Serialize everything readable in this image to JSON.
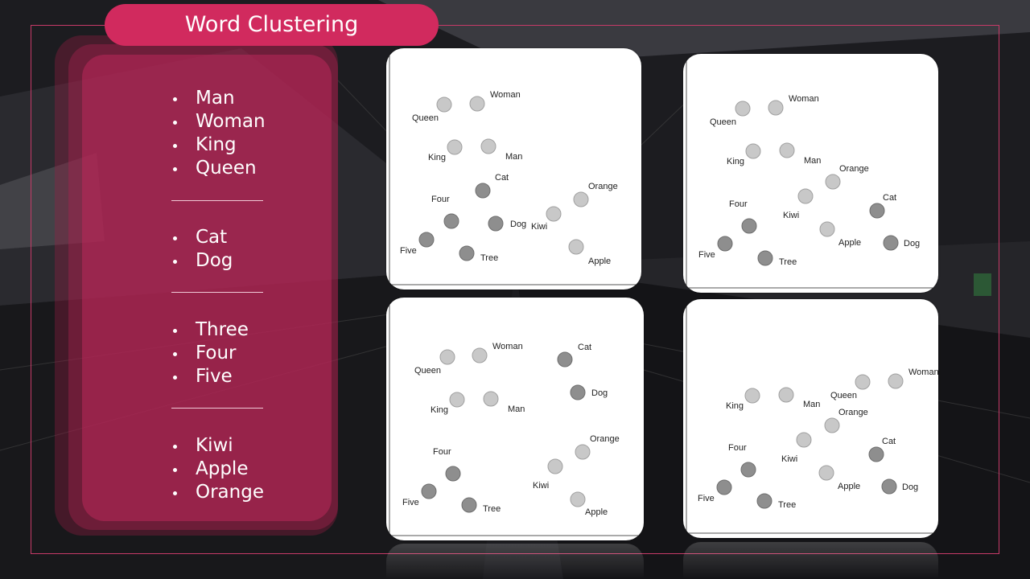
{
  "title": "Word Clustering",
  "colors": {
    "accent": "#d12a5e",
    "frame": "#c63a68",
    "dot_light": "#c8c8c8",
    "dot_dark": "#8e8e8e"
  },
  "word_groups": [
    [
      "Man",
      "Woman",
      "King",
      "Queen"
    ],
    [
      "Cat",
      "Dog"
    ],
    [
      "Three",
      "Four",
      "Five"
    ],
    [
      "Kiwi",
      "Apple",
      "Orange"
    ]
  ],
  "plots": [
    {
      "points": [
        {
          "label": "Queen",
          "tone": "light"
        },
        {
          "label": "Woman",
          "tone": "light"
        },
        {
          "label": "King",
          "tone": "light"
        },
        {
          "label": "Man",
          "tone": "light"
        },
        {
          "label": "Cat",
          "tone": "dark"
        },
        {
          "label": "Four",
          "tone": "dark"
        },
        {
          "label": "Dog",
          "tone": "dark"
        },
        {
          "label": "Five",
          "tone": "dark"
        },
        {
          "label": "Tree",
          "tone": "dark"
        },
        {
          "label": "Kiwi",
          "tone": "light"
        },
        {
          "label": "Orange",
          "tone": "light"
        },
        {
          "label": "Apple",
          "tone": "light"
        }
      ]
    },
    {
      "points": [
        {
          "label": "Queen",
          "tone": "light"
        },
        {
          "label": "Woman",
          "tone": "light"
        },
        {
          "label": "King",
          "tone": "light"
        },
        {
          "label": "Man",
          "tone": "light"
        },
        {
          "label": "Orange",
          "tone": "light"
        },
        {
          "label": "Kiwi",
          "tone": "light"
        },
        {
          "label": "Four",
          "tone": "dark"
        },
        {
          "label": "Cat",
          "tone": "dark"
        },
        {
          "label": "Apple",
          "tone": "light"
        },
        {
          "label": "Five",
          "tone": "dark"
        },
        {
          "label": "Dog",
          "tone": "dark"
        },
        {
          "label": "Tree",
          "tone": "dark"
        }
      ]
    },
    {
      "points": [
        {
          "label": "Queen",
          "tone": "light"
        },
        {
          "label": "Woman",
          "tone": "light"
        },
        {
          "label": "Cat",
          "tone": "dark"
        },
        {
          "label": "King",
          "tone": "light"
        },
        {
          "label": "Man",
          "tone": "light"
        },
        {
          "label": "Dog",
          "tone": "dark"
        },
        {
          "label": "Four",
          "tone": "dark"
        },
        {
          "label": "Orange",
          "tone": "light"
        },
        {
          "label": "Kiwi",
          "tone": "light"
        },
        {
          "label": "Five",
          "tone": "dark"
        },
        {
          "label": "Tree",
          "tone": "dark"
        },
        {
          "label": "Apple",
          "tone": "light"
        }
      ]
    },
    {
      "points": [
        {
          "label": "King",
          "tone": "light"
        },
        {
          "label": "Man",
          "tone": "light"
        },
        {
          "label": "Queen",
          "tone": "light"
        },
        {
          "label": "Woman",
          "tone": "light"
        },
        {
          "label": "Orange",
          "tone": "light"
        },
        {
          "label": "Kiwi",
          "tone": "light"
        },
        {
          "label": "Four",
          "tone": "dark"
        },
        {
          "label": "Cat",
          "tone": "dark"
        },
        {
          "label": "Apple",
          "tone": "light"
        },
        {
          "label": "Five",
          "tone": "dark"
        },
        {
          "label": "Dog",
          "tone": "dark"
        },
        {
          "label": "Tree",
          "tone": "dark"
        }
      ]
    }
  ]
}
